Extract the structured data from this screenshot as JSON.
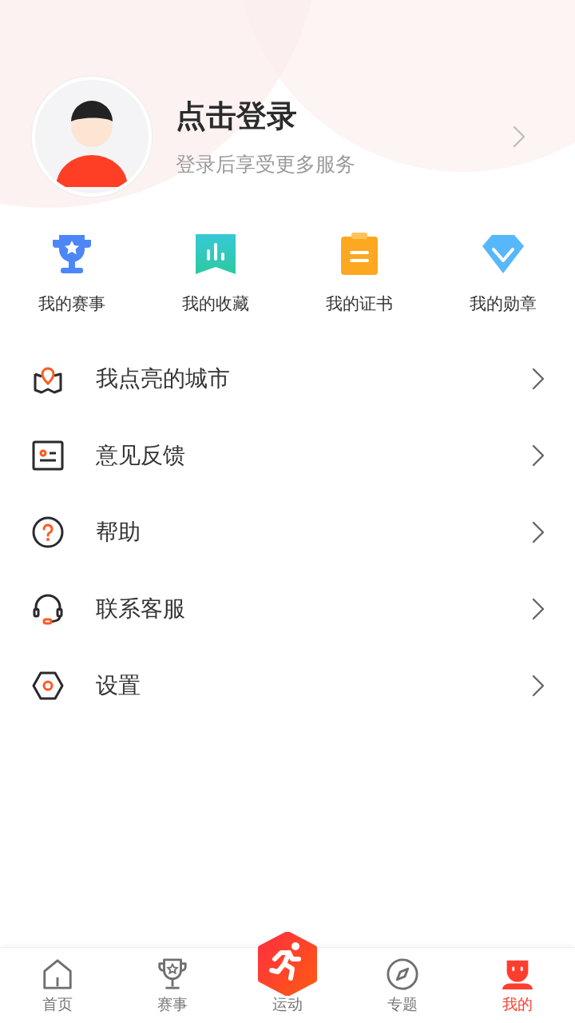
{
  "profile": {
    "title": "点击登录",
    "subtitle": "登录后享受更多服务"
  },
  "shortcuts": [
    {
      "kind": "trophy",
      "label": "我的赛事"
    },
    {
      "kind": "bookmark",
      "label": "我的收藏"
    },
    {
      "kind": "clipboard",
      "label": "我的证书"
    },
    {
      "kind": "diamond",
      "label": "我的勋章"
    }
  ],
  "menu": [
    {
      "kind": "map",
      "label": "我点亮的城市"
    },
    {
      "kind": "feedback",
      "label": "意见反馈"
    },
    {
      "kind": "help",
      "label": "帮助"
    },
    {
      "kind": "headset",
      "label": "联系客服"
    },
    {
      "kind": "settings",
      "label": "设置"
    }
  ],
  "tabs": [
    {
      "kind": "home",
      "label": "首页",
      "selected": false
    },
    {
      "kind": "trophy",
      "label": "赛事",
      "selected": false
    },
    {
      "kind": "run",
      "label": "运动",
      "selected": false
    },
    {
      "kind": "compass",
      "label": "专题",
      "selected": false
    },
    {
      "kind": "profile",
      "label": "我的",
      "selected": true
    }
  ]
}
